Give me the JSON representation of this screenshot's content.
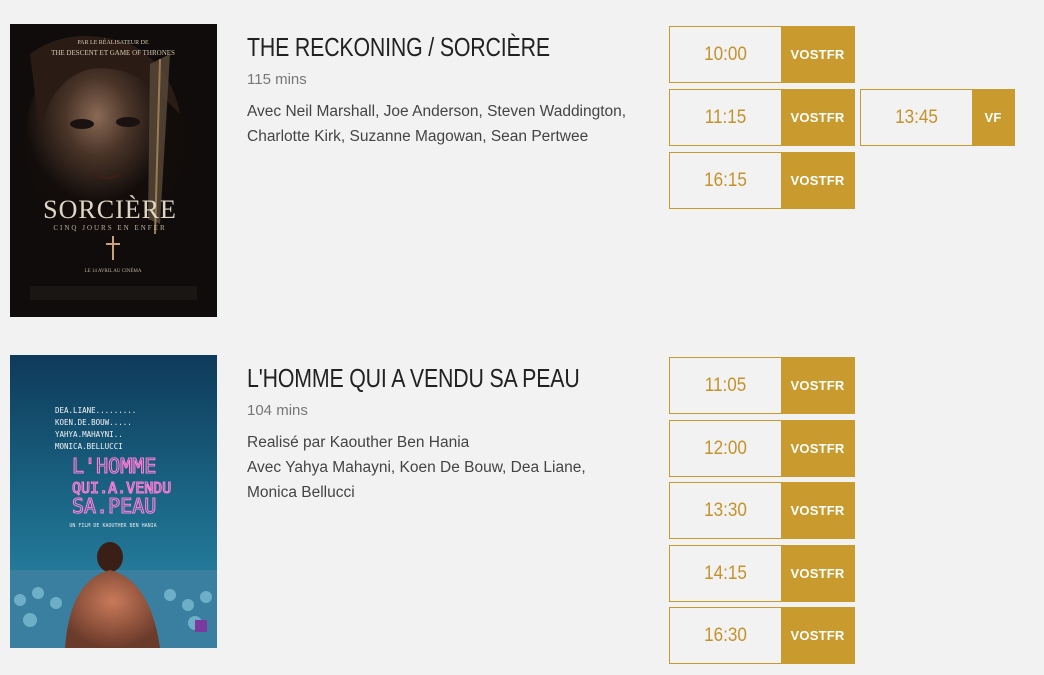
{
  "colors": {
    "accent": "#c99a2e",
    "time_text": "#c4922a",
    "background": "#f2f2f2"
  },
  "movies": [
    {
      "title": "THE RECKONING / SORCIÈRE",
      "duration": "115 mins",
      "credits": [
        "Avec Neil Marshall, Joe Anderson, Steven Waddington, Charlotte Kirk, Suzanne Magowan, Sean Pertwee"
      ],
      "poster": {
        "tagline_1": "PAR LE RÉALISATEUR DE",
        "tagline_2": "THE DESCENT ET GAME OF THRONES",
        "title": "SORCIÈRE",
        "subtitle": "CINQ JOURS EN ENFER",
        "release": "LE 14 AVRIL AU CINÉMA"
      },
      "showtimes": [
        {
          "time": "10:00",
          "lang": "VOSTFR"
        },
        {
          "time": "11:15",
          "lang": "VOSTFR"
        },
        {
          "time": "13:45",
          "lang": "VF"
        },
        {
          "time": "16:15",
          "lang": "VOSTFR"
        }
      ]
    },
    {
      "title": "L'HOMME QUI A VENDU SA PEAU",
      "duration": "104 mins",
      "credits": [
        "Realisé par Kaouther Ben Hania",
        "Avec Yahya Mahayni, Koen De Bouw, Dea Liane, Monica Bellucci"
      ],
      "poster": {
        "cast_1": "DEA.LIANE.........",
        "cast_2": "KOEN.DE.BOUW.....",
        "cast_3": "YAHYA.MAHAYNI..",
        "cast_4": "MONICA.BELLUCCI",
        "title_1": "L'HOMME",
        "title_2": "QUI.A.VENDU",
        "title_3": "SA.PEAU",
        "director": "UN FILM DE KAOUTHER BEN HANIA"
      },
      "showtimes": [
        {
          "time": "11:05",
          "lang": "VOSTFR"
        },
        {
          "time": "12:00",
          "lang": "VOSTFR"
        },
        {
          "time": "13:30",
          "lang": "VOSTFR"
        },
        {
          "time": "14:15",
          "lang": "VOSTFR"
        },
        {
          "time": "16:30",
          "lang": "VOSTFR"
        }
      ]
    }
  ]
}
